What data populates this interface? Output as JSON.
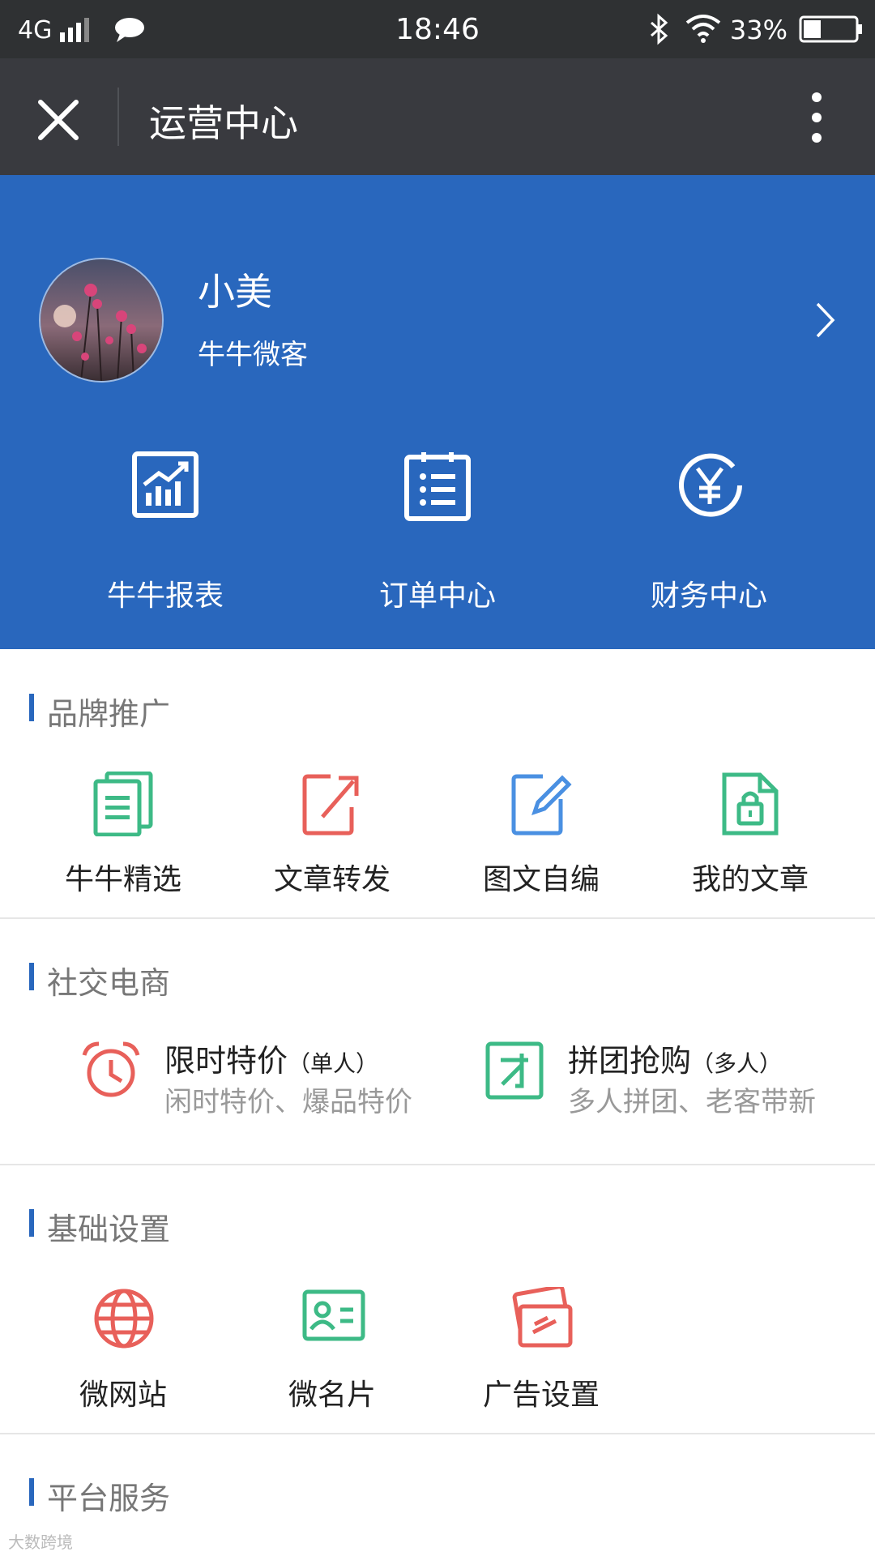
{
  "status_bar": {
    "network": "4G",
    "time": "18:46",
    "battery": "33%"
  },
  "title_bar": {
    "title": "运营中心"
  },
  "profile": {
    "name": "小美",
    "subtitle": "牛牛微客"
  },
  "quick_actions": [
    {
      "label": "牛牛报表",
      "icon": "chart-report-icon"
    },
    {
      "label": "订单中心",
      "icon": "order-list-icon"
    },
    {
      "label": "财务中心",
      "icon": "yen-finance-icon"
    }
  ],
  "brand": {
    "title": "品牌推广",
    "items": [
      {
        "label": "牛牛精选",
        "icon": "documents-icon"
      },
      {
        "label": "文章转发",
        "icon": "share-export-icon"
      },
      {
        "label": "图文自编",
        "icon": "edit-pen-icon"
      },
      {
        "label": "我的文章",
        "icon": "locked-file-icon"
      }
    ]
  },
  "social": {
    "title": "社交电商",
    "items": [
      {
        "title": "限时特价",
        "tag": "（单人）",
        "desc": "闲时特价、爆品特价",
        "icon": "alarm-clock-icon"
      },
      {
        "title": "拼团抢购",
        "tag": "（多人）",
        "desc": "多人拼团、老客带新",
        "icon": "group-buy-icon"
      }
    ]
  },
  "basic": {
    "title": "基础设置",
    "items": [
      {
        "label": "微网站",
        "icon": "globe-icon"
      },
      {
        "label": "微名片",
        "icon": "business-card-icon"
      },
      {
        "label": "广告设置",
        "icon": "ad-cards-icon"
      }
    ]
  },
  "platform": {
    "title": "平台服务"
  },
  "watermark": "大数跨境",
  "colors": {
    "primary_blue": "#2967bd",
    "green": "#3dba86",
    "red": "#e8605a",
    "light_blue": "#4a90e2",
    "title_bar": "#393a3f"
  }
}
